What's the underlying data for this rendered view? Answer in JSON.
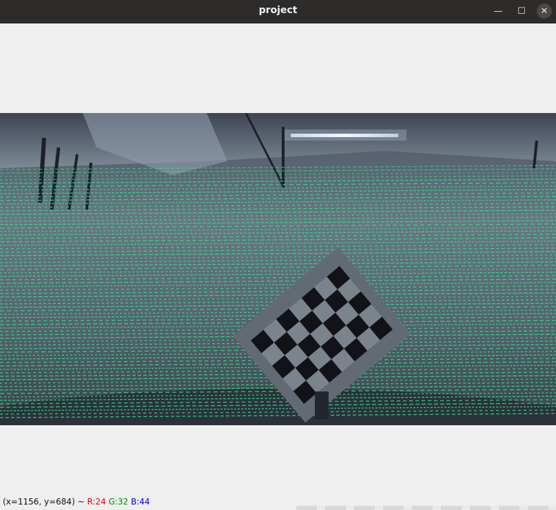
{
  "window": {
    "title": "project",
    "minimize_glyph": "—",
    "maximize_glyph": "☐",
    "close_glyph": "✕"
  },
  "statusbar": {
    "coords": "(x=1156, y=684) ~",
    "r": "R:24",
    "g": "G:32",
    "b": "B:44"
  },
  "image": {
    "point_color": "#22e88a",
    "checkerboard": {
      "rows": 7,
      "cols": 5
    }
  }
}
